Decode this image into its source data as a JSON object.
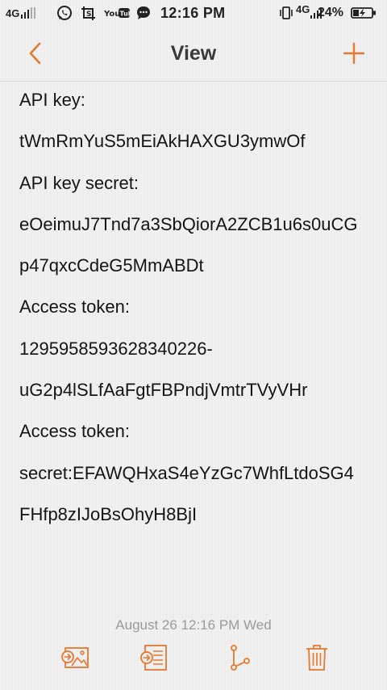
{
  "status_bar": {
    "network_left": "4G",
    "time": "12:16 PM",
    "network_right": "4G",
    "battery_percent": "24%",
    "youtube_label": "YouTube",
    "icons": [
      "signal-icon",
      "whatsapp-icon",
      "screenshot-icon",
      "youtube-icon",
      "chat-icon",
      "vibrate-icon",
      "signal-4g-icon",
      "battery-charging-icon"
    ]
  },
  "header": {
    "title": "View",
    "back_icon": "chevron-left-icon",
    "add_icon": "plus-icon"
  },
  "note": {
    "lines": [
      "API key:",
      "tWmRmYuS5mEiAkHAXGU3ymwOf",
      "API key secret:",
      "eOeimuJ7Tnd7a3SbQiorA2ZCB1u6s0uCG",
      "p47qxcCdeG5MmABDt",
      "Access token:",
      "1295958593628340226-",
      "uG2p4lSLfAaFgtFBPndjVmtrTVyVHr",
      "Access token:",
      "secret:EFAWQHxaS4eYzGc7WhfLtdoSG4",
      "FHfp8zIJoBsOhyH8BjI"
    ],
    "date": "August 26 12:16 PM Wed"
  },
  "toolbar": {
    "items": [
      "share-as-image-icon",
      "share-as-text-icon",
      "branch-icon",
      "delete-icon"
    ]
  },
  "colors": {
    "accent": "#e8772e",
    "background": "#efefef",
    "text": "#141414",
    "date_text": "#9a9a9a"
  }
}
